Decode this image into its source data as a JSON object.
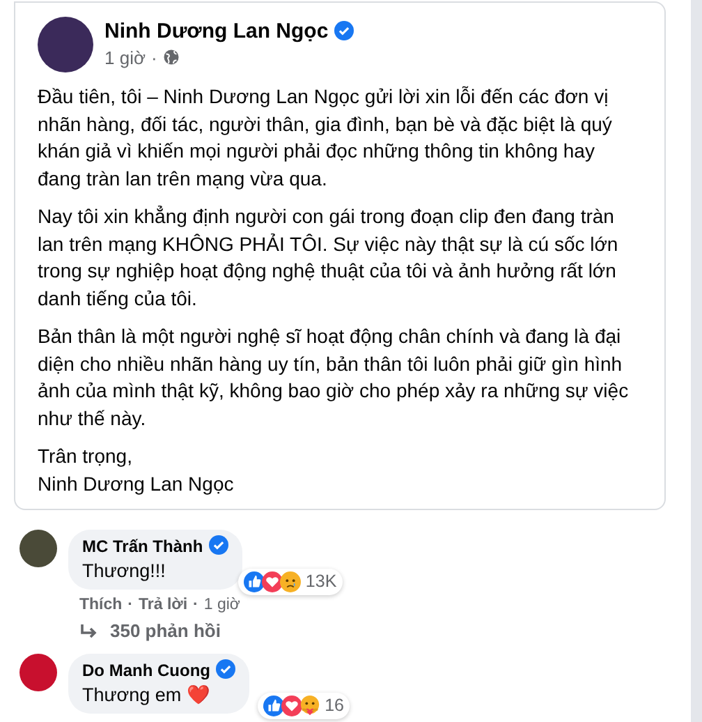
{
  "post": {
    "author": "Ninh Dương Lan Ngọc",
    "verified": true,
    "time": "1 giờ",
    "separator": "·",
    "paragraphs": [
      "Đầu tiên, tôi – Ninh Dương Lan Ngọc gửi lời xin lỗi đến các đơn vị nhãn hàng, đối tác, người thân, gia đình, bạn bè và đặc biệt là quý khán giả vì khiến mọi người phải đọc những thông tin không hay đang tràn lan trên mạng vừa qua.",
      "Nay tôi xin khẳng định người con gái trong đoạn clip đen đang tràn lan trên mạng KHÔNG PHẢI TÔI. Sự việc này thật sự là cú sốc lớn trong sự nghiệp hoạt động nghệ thuật của tôi và ảnh hưởng rất lớn danh tiếng của tôi.",
      "Bản thân là một người nghệ sĩ hoạt động chân chính và đang là đại diện cho nhiều nhãn hàng uy tín, bản thân tôi luôn phải giữ gìn hình ảnh của mình thật kỹ, không bao giờ cho phép xảy ra những sự việc như thế này."
    ],
    "signoff": [
      "Trân trọng,",
      "Ninh Dương Lan Ngọc"
    ]
  },
  "comments": [
    {
      "author": "MC Trấn Thành",
      "verified": true,
      "text": "Thương!!!",
      "reactions": [
        {
          "kind": "like"
        },
        {
          "kind": "love"
        },
        {
          "kind": "sad"
        }
      ],
      "reaction_count": "13K",
      "actions": [
        "Thích",
        "Trả lời",
        "1 giờ"
      ],
      "replies": "350 phản hồi"
    },
    {
      "author": "Do Manh Cuong",
      "verified": true,
      "text": "Thương em ❤️",
      "reactions": [
        {
          "kind": "like"
        },
        {
          "kind": "love"
        },
        {
          "kind": "care"
        }
      ],
      "reaction_count": "16"
    }
  ]
}
